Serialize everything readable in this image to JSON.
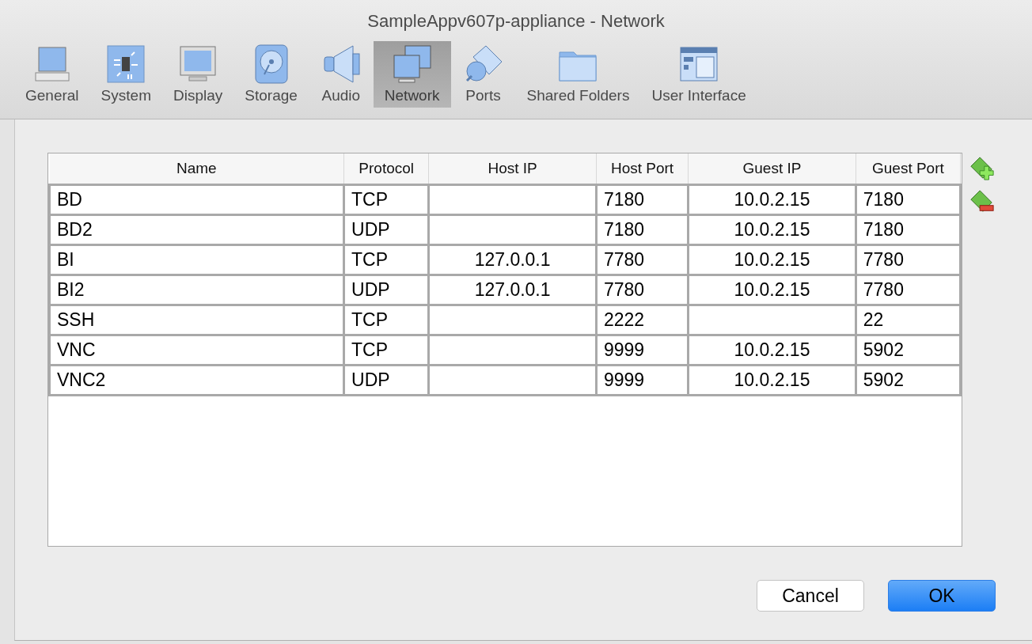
{
  "window": {
    "title": "SampleAppv607p-appliance - Network"
  },
  "toolbar": [
    {
      "label": "General",
      "selected": false
    },
    {
      "label": "System",
      "selected": false
    },
    {
      "label": "Display",
      "selected": false
    },
    {
      "label": "Storage",
      "selected": false
    },
    {
      "label": "Audio",
      "selected": false
    },
    {
      "label": "Network",
      "selected": true
    },
    {
      "label": "Ports",
      "selected": false
    },
    {
      "label": "Shared Folders",
      "selected": false
    },
    {
      "label": "User Interface",
      "selected": false
    }
  ],
  "table": {
    "columns": [
      "Name",
      "Protocol",
      "Host IP",
      "Host Port",
      "Guest IP",
      "Guest Port"
    ],
    "rows": [
      [
        "BD",
        "TCP",
        "",
        "7180",
        "10.0.2.15",
        "7180"
      ],
      [
        "BD2",
        "UDP",
        "",
        "7180",
        "10.0.2.15",
        "7180"
      ],
      [
        "BI",
        "TCP",
        "127.0.0.1",
        "7780",
        "10.0.2.15",
        "7780"
      ],
      [
        "BI2",
        "UDP",
        "127.0.0.1",
        "7780",
        "10.0.2.15",
        "7780"
      ],
      [
        "SSH",
        "TCP",
        "",
        "2222",
        "",
        "22"
      ],
      [
        "VNC",
        "TCP",
        "",
        "9999",
        "10.0.2.15",
        "5902"
      ],
      [
        "VNC2",
        "UDP",
        "",
        "9999",
        "10.0.2.15",
        "5902"
      ]
    ]
  },
  "buttons": [
    {
      "label": "Cancel",
      "kind": "normal"
    },
    {
      "label": "OK",
      "kind": "default"
    }
  ]
}
